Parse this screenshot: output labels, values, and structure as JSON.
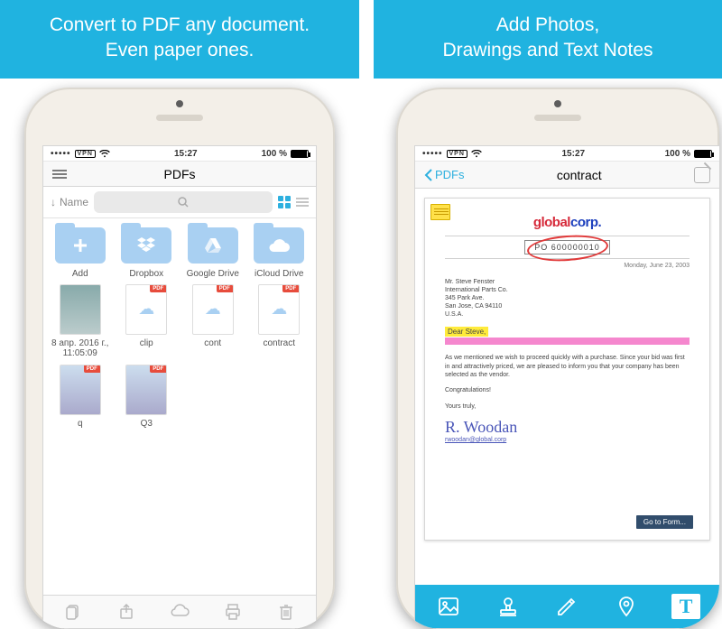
{
  "captions": {
    "left_line1": "Convert to PDF any document.",
    "left_line2": "Even paper ones.",
    "right_line1": "Add Photos,",
    "right_line2": "Drawings and Text Notes"
  },
  "statusbar": {
    "signal_text": "•••••",
    "carrier_badge": "VPN",
    "wifi": "wifi",
    "time": "15:27",
    "battery_pct": "100 %"
  },
  "left_screen": {
    "nav_title": "PDFs",
    "sort_arrow": "↓",
    "sort_label": "Name",
    "search_glyph": "⌕",
    "folders": [
      {
        "glyph": "+",
        "label": "Add",
        "name": "folder-add"
      },
      {
        "glyph": "dropbox",
        "label": "Dropbox",
        "name": "folder-dropbox"
      },
      {
        "glyph": "gdrive",
        "label": "Google Drive",
        "name": "folder-gdrive"
      },
      {
        "glyph": "cloud",
        "label": "iCloud Drive",
        "name": "folder-icloud"
      }
    ],
    "files_row1": [
      {
        "kind": "photo",
        "label": "8 апр. 2016 г., 11:05:09",
        "name": "file-photo"
      },
      {
        "kind": "pdf-cloud",
        "label": "clip",
        "name": "file-clip"
      },
      {
        "kind": "pdf-cloud",
        "label": "cont",
        "name": "file-cont"
      },
      {
        "kind": "pdf-cloud",
        "label": "contract",
        "name": "file-contract"
      }
    ],
    "files_row2": [
      {
        "kind": "pdf-thumb",
        "label": "q",
        "name": "file-q"
      },
      {
        "kind": "pdf-thumb",
        "label": "Q3",
        "name": "file-q3"
      }
    ],
    "badge_text": "PDF"
  },
  "right_screen": {
    "back_label": "PDFs",
    "nav_title": "contract",
    "doc": {
      "logo_a": "global",
      "logo_b": "corp.",
      "po": "PO 600000010",
      "date": "Monday, June 23, 2003",
      "addr": "Mr. Steve Fenster\nInternational Parts Co.\n345 Park Ave.\nSan Jose, CA 94110\nU.S.A.",
      "dear": "Dear Steve,",
      "body1": "As we mentioned we wish to proceed quickly with a purchase. Since your bid was first in and attractively priced, we are pleased to inform you that your company has been selected as the vendor.",
      "congrats": "Congratulations!",
      "closing": "Yours truly,",
      "sig": "R. Woodan",
      "siglink": "rwoodan@global.corp",
      "goto": "Go to Form..."
    },
    "tools": [
      {
        "name": "photo-tool",
        "glyph": "photo"
      },
      {
        "name": "stamp-tool",
        "glyph": "stamp"
      },
      {
        "name": "pencil-tool",
        "glyph": "pencil"
      },
      {
        "name": "pin-tool",
        "glyph": "pin"
      },
      {
        "name": "text-tool",
        "glyph": "T",
        "selected": true
      }
    ]
  }
}
